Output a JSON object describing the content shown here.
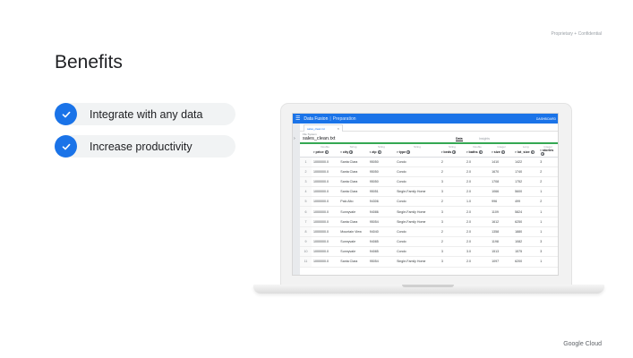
{
  "confidential_label": "Proprietary + Confidential",
  "slide_title": "Benefits",
  "benefits": [
    {
      "label": "Integrate with any data"
    },
    {
      "label": "Increase productivity"
    }
  ],
  "app": {
    "menu_glyph": "☰",
    "name": "Data Fusion",
    "separator": "|",
    "page": "Preparation",
    "right_label": "DASHBOARD",
    "tab_label": "sales_clean.txt",
    "tab_close": "×",
    "file_label": "File System",
    "file_name": "sales_clean.txt",
    "view_data": "Data",
    "view_insights": "Insights",
    "collapse_glyph": "›"
  },
  "table": {
    "types": [
      "Double",
      "String",
      "String",
      "String",
      "String",
      "Double",
      "Integer",
      "Long",
      "Integer"
    ],
    "columns": [
      "price",
      "city",
      "zip",
      "type",
      "beds",
      "baths",
      "size",
      "lot_size",
      "stories"
    ],
    "rows": [
      [
        "1",
        "1000000.0",
        "Santa Clara",
        "95050",
        "Condo",
        "2",
        "2.0",
        "1410",
        "1422",
        "3"
      ],
      [
        "2",
        "1000000.0",
        "Santa Clara",
        "95050",
        "Condo",
        "2",
        "2.0",
        "1670",
        "1740",
        "2"
      ],
      [
        "3",
        "1000000.0",
        "Santa Clara",
        "95050",
        "Condo",
        "3",
        "2.0",
        "1708",
        "1752",
        "2"
      ],
      [
        "4",
        "1000000.0",
        "Santa Clara",
        "95051",
        "Single-Family Home",
        "3",
        "2.0",
        "1066",
        "5600",
        "1"
      ],
      [
        "5",
        "1000000.0",
        "Palo Alto",
        "94306",
        "Condo",
        "2",
        "1.0",
        "996",
        "499",
        "2"
      ],
      [
        "6",
        "1000000.0",
        "Sunnyvale",
        "94086",
        "Single-Family Home",
        "3",
        "2.0",
        "1109",
        "5824",
        "1"
      ],
      [
        "7",
        "1000000.0",
        "Santa Clara",
        "95054",
        "Single-Family Home",
        "3",
        "2.0",
        "1612",
        "6250",
        "1"
      ],
      [
        "8",
        "1000000.0",
        "Mountain View",
        "94040",
        "Condo",
        "2",
        "2.0",
        "1358",
        "1880",
        "1"
      ],
      [
        "9",
        "1000000.0",
        "Sunnyvale",
        "94085",
        "Condo",
        "2",
        "2.0",
        "1198",
        "1082",
        "3"
      ],
      [
        "10",
        "1000000.0",
        "Sunnyvale",
        "94085",
        "Condo",
        "3",
        "3.0",
        "1513",
        "1575",
        "3"
      ],
      [
        "11",
        "1000000.0",
        "Santa Clara",
        "95054",
        "Single-Family Home",
        "3",
        "2.0",
        "1097",
        "6200",
        "1"
      ]
    ]
  },
  "footer": "Google Cloud",
  "colors": {
    "accent": "#1a73e8",
    "pill_bg": "#f1f3f4",
    "progress": "#34a853"
  }
}
